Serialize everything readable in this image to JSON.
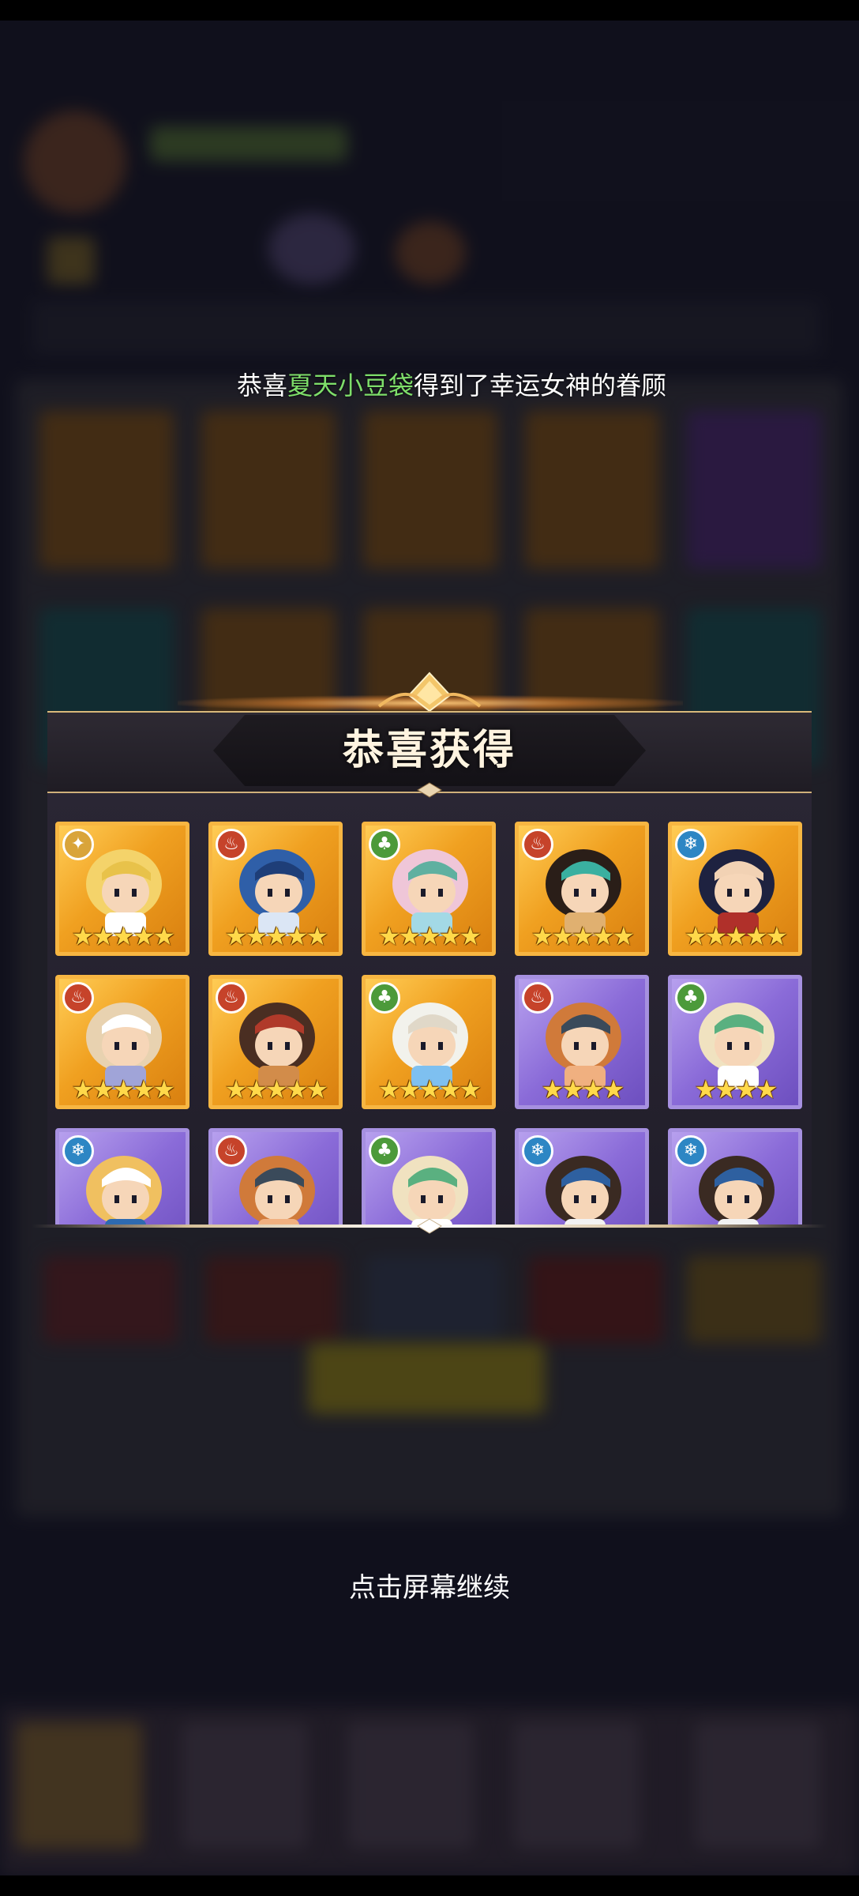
{
  "announcement": {
    "prefix": "恭喜",
    "player": "夏天小豆袋",
    "suffix": "得到了幸运女神的眷顾"
  },
  "reward_panel": {
    "title": "恭喜获得",
    "cards": [
      {
        "frame": "gold",
        "element": "light-icon",
        "stars": "★★★★★",
        "character": "winged-knight-hero"
      },
      {
        "frame": "gold",
        "element": "fire-icon",
        "stars": "★★★★★",
        "character": "blue-wolf-hero"
      },
      {
        "frame": "gold",
        "element": "nature-icon",
        "stars": "★★★★★",
        "character": "pink-haired-elf-hero"
      },
      {
        "frame": "gold",
        "element": "fire-icon",
        "stars": "★★★★★",
        "character": "anubis-girl-hero"
      },
      {
        "frame": "gold",
        "element": "water-icon",
        "stars": "★★★★★",
        "character": "witch-hat-hero"
      },
      {
        "frame": "gold",
        "element": "fire-icon",
        "stars": "★★★★★",
        "character": "fox-girl-with-yeti-hero"
      },
      {
        "frame": "gold",
        "element": "fire-icon",
        "stars": "★★★★★",
        "character": "cat-eared-girl-hero"
      },
      {
        "frame": "gold",
        "element": "nature-icon",
        "stars": "★★★★★",
        "character": "fairy-wings-hero"
      },
      {
        "frame": "purple",
        "element": "fire-icon",
        "stars": "★★★★",
        "character": "dwarf-warrior-hero"
      },
      {
        "frame": "purple",
        "element": "nature-icon",
        "stars": "★★★★",
        "character": "antlered-druid-hero"
      },
      {
        "frame": "purple",
        "element": "water-icon",
        "stars": "",
        "character": "blond-swordsman-hero"
      },
      {
        "frame": "purple",
        "element": "fire-icon",
        "stars": "",
        "character": "dwarf-warrior-hero"
      },
      {
        "frame": "purple",
        "element": "nature-icon",
        "stars": "",
        "character": "antlered-druid-hero"
      },
      {
        "frame": "purple",
        "element": "water-icon",
        "stars": "",
        "character": "horned-helmet-warrior-hero"
      },
      {
        "frame": "purple",
        "element": "water-icon",
        "stars": "",
        "character": "horned-helmet-warrior-hero"
      }
    ]
  },
  "hint": "点击屏幕继续",
  "colors": {
    "highlight_name": "#7ede6a",
    "gold_frame": "#f7b642",
    "purple_frame": "#a690e0"
  }
}
